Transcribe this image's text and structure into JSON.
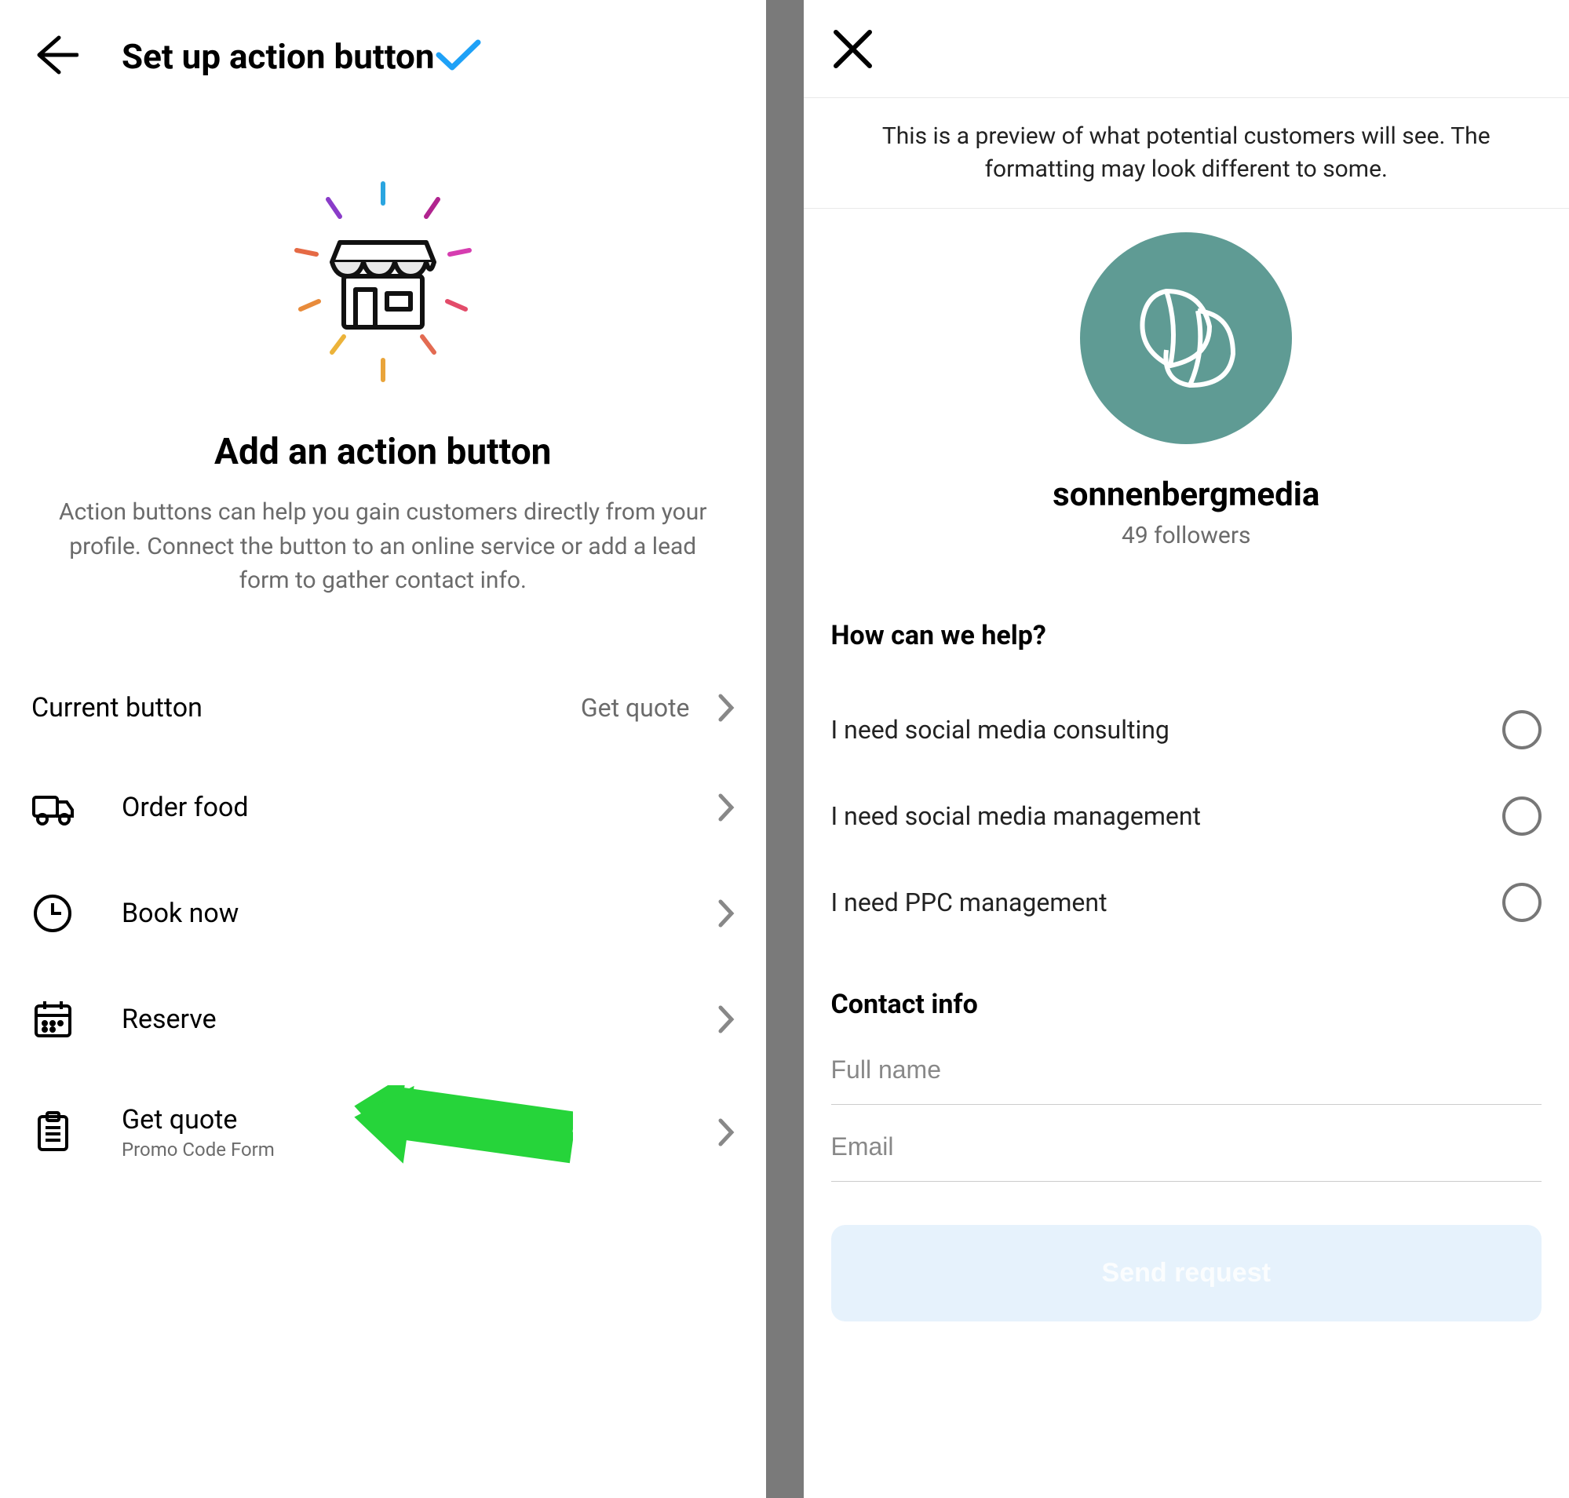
{
  "left": {
    "header_title": "Set up action button",
    "hero_title": "Add an action button",
    "hero_desc": "Action buttons can help you gain customers directly from your profile. Connect the button to an online service or add a lead form to gather contact info.",
    "current_label": "Current button",
    "current_value": "Get quote",
    "options": [
      {
        "label": "Order food",
        "sub": ""
      },
      {
        "label": "Book now",
        "sub": ""
      },
      {
        "label": "Reserve",
        "sub": ""
      },
      {
        "label": "Get quote",
        "sub": "Promo Code Form"
      }
    ]
  },
  "right": {
    "preview_note": "This is a preview of what potential customers will see. The formatting may look different to some.",
    "username": "sonnenbergmedia",
    "followers": "49 followers",
    "help_heading": "How can we help?",
    "options": [
      "I need social media consulting",
      "I need social media management",
      "I need PPC management"
    ],
    "contact_heading": "Contact info",
    "fullname_ph": "Full name",
    "email_ph": "Email",
    "send_label": "Send request"
  }
}
